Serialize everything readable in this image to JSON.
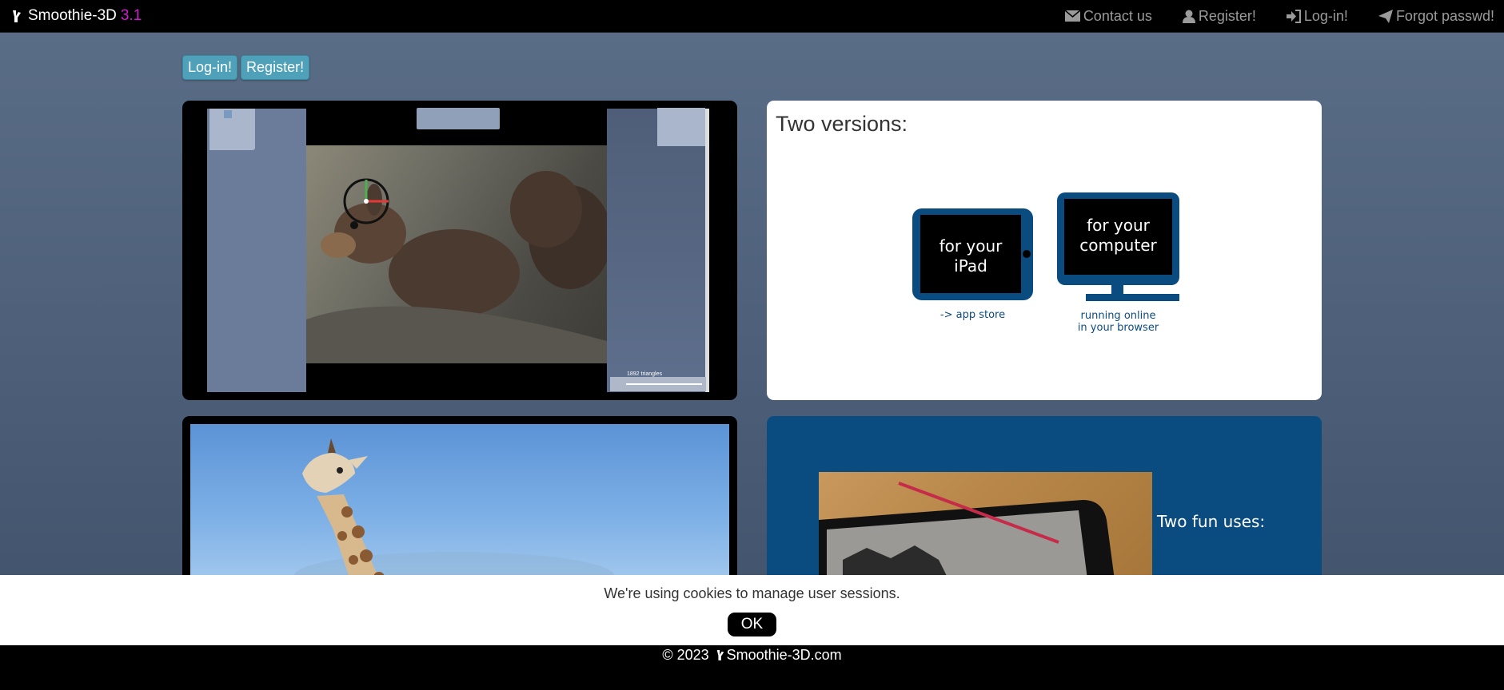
{
  "navbar": {
    "brand": "Smoothie-3D",
    "version": "3.1",
    "links": {
      "contact": "Contact us",
      "register": "Register!",
      "login": "Log-in!",
      "forgot": "Forgot passwd!"
    }
  },
  "auth": {
    "login_label": "Log-in!",
    "register_label": "Register!"
  },
  "editor_card": {
    "status": "1892 triangles"
  },
  "versions_card": {
    "title": "Two versions:",
    "ipad_line1": "for your",
    "ipad_line2": "iPad",
    "ipad_caption": "-> app store",
    "computer_line1": "for your",
    "computer_line2": "computer",
    "computer_caption_line1": "running online",
    "computer_caption_line2": "in your browser"
  },
  "fun_card": {
    "title": "Two fun uses:"
  },
  "cookie_banner": {
    "message": "We're using cookies to manage user sessions.",
    "ok_label": "OK"
  },
  "footer": {
    "copyright": "© 2023",
    "site": "Smoothie-3D.com"
  },
  "colors": {
    "brand_version": "#d21bd0",
    "teal_button": "#4ea1b8",
    "navy_card": "#0b4c80"
  }
}
